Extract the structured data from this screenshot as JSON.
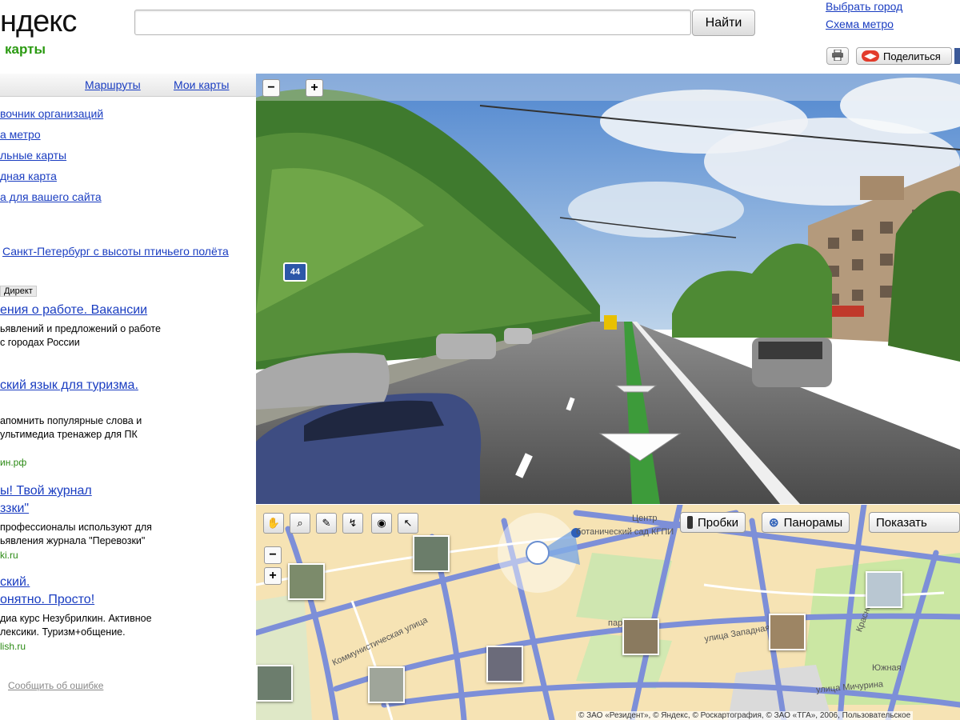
{
  "header": {
    "logo_text": "ндекс",
    "logo_sub": "карты",
    "search_value": "",
    "search_button": "Найти",
    "city_link": "Выбрать город",
    "metro_link": "Схема метро",
    "share_label": "Поделиться"
  },
  "sidebar": {
    "tabs": [
      {
        "label": "Маршруты"
      },
      {
        "label": "Мои карты"
      }
    ],
    "links": [
      {
        "label": "вочник организаций"
      },
      {
        "label": "а метро"
      },
      {
        "label": "льные карты"
      },
      {
        "label": "дная карта"
      },
      {
        "label": "а для вашего сайта"
      }
    ],
    "spb_link": "Санкт-Петербург с высоты птичьего полёта",
    "direct_label": "Директ",
    "ads": [
      {
        "title": [
          "ения о работе. Вакансии"
        ],
        "text": [
          "ьявлений и предложений о работе",
          "с городах России"
        ],
        "domain": ""
      },
      {
        "title": [
          "ский язык для туризма."
        ],
        "text": [
          "апомнить популярные слова и",
          "ультимедиа тренажер для ПК"
        ],
        "domain": "ин.рф"
      },
      {
        "title": [
          "ы! Твой журнал",
          "ззки\""
        ],
        "text": [
          "профессионалы используют для",
          "ьявления журнала \"Перевозки\""
        ],
        "domain": "ki.ru"
      },
      {
        "title": [
          "ский.",
          "онятно. Просто!"
        ],
        "text": [
          "диа курс Незубрилкин. Активное",
          "лексики. Туризм+общение."
        ],
        "domain": "lish.ru"
      }
    ],
    "report_error": "Сообщить об ошибке"
  },
  "panorama": {
    "zoom_out": "−",
    "zoom_in": "+",
    "road_sign": "44"
  },
  "map": {
    "layers": [
      {
        "label": "Пробки",
        "icon": "traffic-light-icon"
      },
      {
        "label": "Панорамы",
        "icon": "panorama-icon"
      },
      {
        "label": "Показать",
        "icon": ""
      }
    ],
    "zoom_out": "−",
    "zoom_in": "+",
    "street_labels": [
      "ботанический сад КГПИ",
      "улица Западная",
      "Коммунистическая улица",
      "улица Мичурина",
      "парк",
      "Краснова",
      "Центр",
      "Южная"
    ],
    "copyright": "© ЗАО «Резидент», © Яндекс, © Роскартография, © ЗАО «ТГА», 2006, Пользовательское"
  },
  "colors": {
    "link": "#1a3dc1",
    "ad_domain": "#2b8a14",
    "logo_green": "#2b9a12",
    "map_road": "#7d8fd8",
    "map_bg": "#f6e3b4"
  }
}
